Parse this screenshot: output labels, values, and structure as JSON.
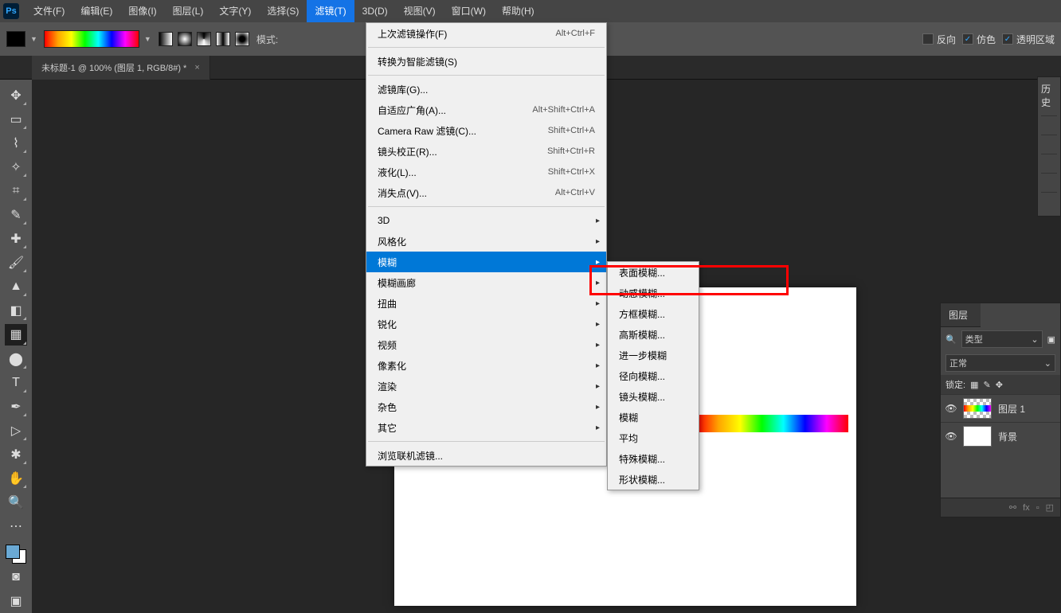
{
  "menubar": {
    "items": [
      "文件(F)",
      "编辑(E)",
      "图像(I)",
      "图层(L)",
      "文字(Y)",
      "选择(S)",
      "滤镜(T)",
      "3D(D)",
      "视图(V)",
      "窗口(W)",
      "帮助(H)"
    ],
    "active_index": 6
  },
  "options": {
    "mode_label": "模式:",
    "reverse": "反向",
    "dither": "仿色",
    "transparency": "透明区域"
  },
  "document_tab": {
    "title": "未标题-1 @ 100% (图层 1, RGB/8#) *",
    "close": "×"
  },
  "filter_menu": {
    "items": [
      {
        "label": "上次滤镜操作(F)",
        "shortcut": "Alt+Ctrl+F"
      },
      {
        "sep": true
      },
      {
        "label": "转换为智能滤镜(S)"
      },
      {
        "sep": true
      },
      {
        "label": "滤镜库(G)..."
      },
      {
        "label": "自适应广角(A)...",
        "shortcut": "Alt+Shift+Ctrl+A"
      },
      {
        "label": "Camera Raw 滤镜(C)...",
        "shortcut": "Shift+Ctrl+A"
      },
      {
        "label": "镜头校正(R)...",
        "shortcut": "Shift+Ctrl+R"
      },
      {
        "label": "液化(L)...",
        "shortcut": "Shift+Ctrl+X"
      },
      {
        "label": "消失点(V)...",
        "shortcut": "Alt+Ctrl+V"
      },
      {
        "sep": true
      },
      {
        "label": "3D",
        "sub": true
      },
      {
        "label": "风格化",
        "sub": true
      },
      {
        "label": "模糊",
        "sub": true,
        "highlight": true
      },
      {
        "label": "模糊画廊",
        "sub": true
      },
      {
        "label": "扭曲",
        "sub": true
      },
      {
        "label": "锐化",
        "sub": true
      },
      {
        "label": "视频",
        "sub": true
      },
      {
        "label": "像素化",
        "sub": true
      },
      {
        "label": "渲染",
        "sub": true
      },
      {
        "label": "杂色",
        "sub": true
      },
      {
        "label": "其它",
        "sub": true
      },
      {
        "sep": true
      },
      {
        "label": "浏览联机滤镜..."
      }
    ]
  },
  "blur_submenu": {
    "items": [
      {
        "label": "表面模糊..."
      },
      {
        "label": "动感模糊..."
      },
      {
        "label": "方框模糊..."
      },
      {
        "label": "高斯模糊..."
      },
      {
        "label": "进一步模糊"
      },
      {
        "label": "径向模糊..."
      },
      {
        "label": "镜头模糊..."
      },
      {
        "label": "模糊"
      },
      {
        "label": "平均"
      },
      {
        "label": "特殊模糊..."
      },
      {
        "label": "形状模糊..."
      }
    ]
  },
  "layers_panel": {
    "title": "图层",
    "filter_label": "类型",
    "blend_mode": "正常",
    "lock_label": "锁定:",
    "layers": [
      {
        "name": "图层 1",
        "thumb": "rainbow"
      },
      {
        "name": "背景",
        "thumb": "white"
      }
    ],
    "footer_fx": "fx"
  },
  "history_stub": {
    "title": "历史"
  },
  "search_icon_label": "🔍"
}
